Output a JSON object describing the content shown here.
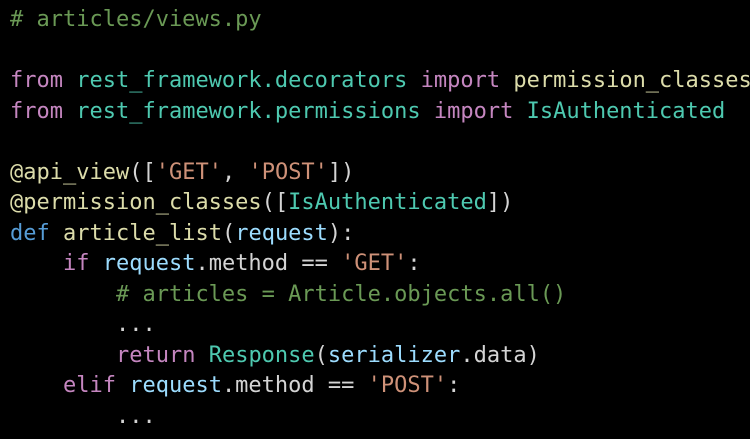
{
  "editor": {
    "colors": {
      "background": "#000000",
      "plain": "#d4d4d4",
      "comment": "#6a9955",
      "keyword": "#c586c0",
      "def_keyword": "#569cd6",
      "module": "#4ec9b0",
      "type": "#4ec9b0",
      "string": "#ce9178",
      "function": "#dcdcaa",
      "variable": "#9cdcfe"
    },
    "lines": [
      {
        "tokens": [
          {
            "text": "# articles/views.py",
            "type": "comment"
          }
        ]
      },
      {
        "tokens": []
      },
      {
        "tokens": [
          {
            "text": "from",
            "type": "keyword"
          },
          {
            "text": " ",
            "type": "plain"
          },
          {
            "text": "rest_framework.decorators",
            "type": "module"
          },
          {
            "text": " ",
            "type": "plain"
          },
          {
            "text": "import",
            "type": "keyword"
          },
          {
            "text": " ",
            "type": "plain"
          },
          {
            "text": "permission_classes",
            "type": "function"
          }
        ]
      },
      {
        "tokens": [
          {
            "text": "from",
            "type": "keyword"
          },
          {
            "text": " ",
            "type": "plain"
          },
          {
            "text": "rest_framework.permissions",
            "type": "module"
          },
          {
            "text": " ",
            "type": "plain"
          },
          {
            "text": "import",
            "type": "keyword"
          },
          {
            "text": " ",
            "type": "plain"
          },
          {
            "text": "IsAuthenticated",
            "type": "type"
          }
        ]
      },
      {
        "tokens": []
      },
      {
        "tokens": [
          {
            "text": "@api_view",
            "type": "function"
          },
          {
            "text": "([",
            "type": "plain"
          },
          {
            "text": "'GET'",
            "type": "string"
          },
          {
            "text": ", ",
            "type": "plain"
          },
          {
            "text": "'POST'",
            "type": "string"
          },
          {
            "text": "])",
            "type": "plain"
          }
        ]
      },
      {
        "tokens": [
          {
            "text": "@permission_classes",
            "type": "function"
          },
          {
            "text": "([",
            "type": "plain"
          },
          {
            "text": "IsAuthenticated",
            "type": "type"
          },
          {
            "text": "])",
            "type": "plain"
          }
        ]
      },
      {
        "tokens": [
          {
            "text": "def",
            "type": "def_keyword"
          },
          {
            "text": " ",
            "type": "plain"
          },
          {
            "text": "article_list",
            "type": "function"
          },
          {
            "text": "(",
            "type": "plain"
          },
          {
            "text": "request",
            "type": "variable"
          },
          {
            "text": "):",
            "type": "plain"
          }
        ]
      },
      {
        "tokens": [
          {
            "text": "    ",
            "type": "plain"
          },
          {
            "text": "if",
            "type": "keyword"
          },
          {
            "text": " ",
            "type": "plain"
          },
          {
            "text": "request",
            "type": "variable"
          },
          {
            "text": ".method == ",
            "type": "plain"
          },
          {
            "text": "'GET'",
            "type": "string"
          },
          {
            "text": ":",
            "type": "plain"
          }
        ]
      },
      {
        "tokens": [
          {
            "text": "        ",
            "type": "plain"
          },
          {
            "text": "# articles = Article.objects.all()",
            "type": "comment"
          }
        ]
      },
      {
        "tokens": [
          {
            "text": "        ...",
            "type": "plain"
          }
        ]
      },
      {
        "tokens": [
          {
            "text": "        ",
            "type": "plain"
          },
          {
            "text": "return",
            "type": "keyword"
          },
          {
            "text": " ",
            "type": "plain"
          },
          {
            "text": "Response",
            "type": "type"
          },
          {
            "text": "(",
            "type": "plain"
          },
          {
            "text": "serializer",
            "type": "variable"
          },
          {
            "text": ".data)",
            "type": "plain"
          }
        ]
      },
      {
        "tokens": [
          {
            "text": "    ",
            "type": "plain"
          },
          {
            "text": "elif",
            "type": "keyword"
          },
          {
            "text": " ",
            "type": "plain"
          },
          {
            "text": "request",
            "type": "variable"
          },
          {
            "text": ".method == ",
            "type": "plain"
          },
          {
            "text": "'POST'",
            "type": "string"
          },
          {
            "text": ":",
            "type": "plain"
          }
        ]
      },
      {
        "tokens": [
          {
            "text": "        ...",
            "type": "plain"
          }
        ]
      }
    ]
  }
}
